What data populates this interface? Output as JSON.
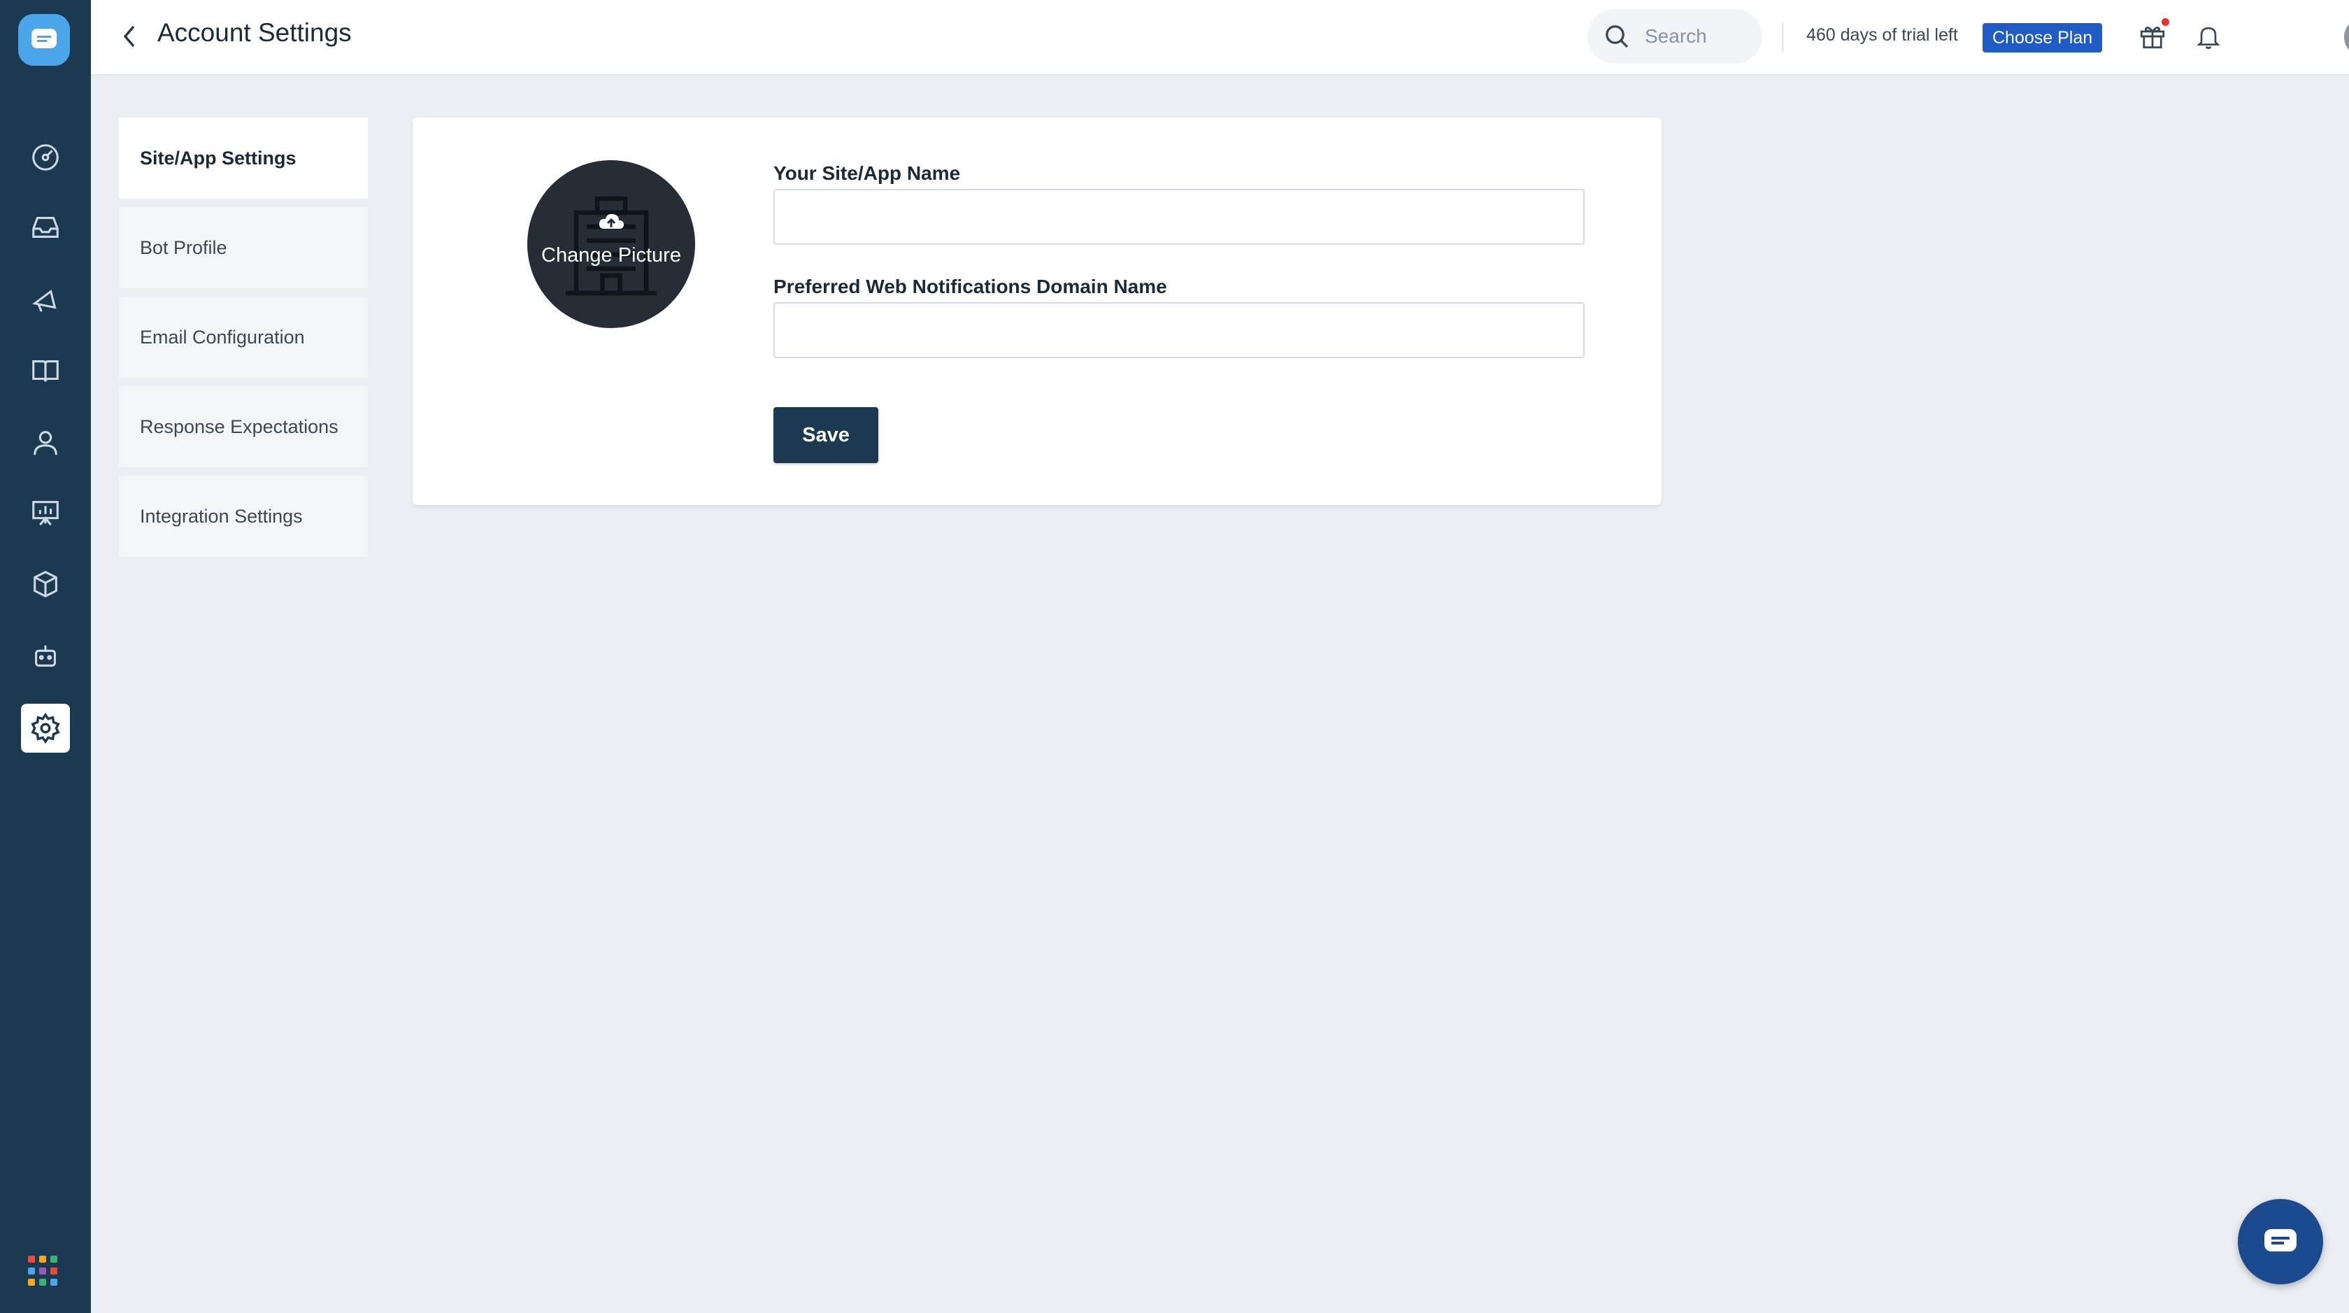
{
  "rail": {
    "items": [
      {
        "icon": "dashboard-icon"
      },
      {
        "icon": "inbox-icon"
      },
      {
        "icon": "campaigns-icon"
      },
      {
        "icon": "knowledge-base-icon"
      },
      {
        "icon": "contacts-icon"
      },
      {
        "icon": "reports-icon"
      },
      {
        "icon": "integrations-icon"
      },
      {
        "icon": "bot-icon"
      },
      {
        "icon": "settings-icon",
        "active": true
      }
    ],
    "apps_colors": [
      "#e94b3c",
      "#f5a623",
      "#3bb273",
      "#4aa6e8",
      "#9b59b6",
      "#e94b3c",
      "#f5a623",
      "#3bb273",
      "#4aa6e8"
    ]
  },
  "header": {
    "title": "Account Settings",
    "search_placeholder": "Search",
    "trial_text": "460 days of trial left",
    "choose_plan_label": "Choose Plan"
  },
  "settings_nav": {
    "items": [
      {
        "label": "Site/App Settings",
        "active": true
      },
      {
        "label": "Bot Profile"
      },
      {
        "label": "Email Configuration"
      },
      {
        "label": "Response Expectations"
      },
      {
        "label": "Integration Settings"
      }
    ]
  },
  "form": {
    "picture_label": "Change Picture",
    "site_name_label": "Your Site/App Name",
    "site_name_value": "",
    "domain_label": "Preferred Web Notifications Domain Name",
    "domain_value": "",
    "save_label": "Save"
  },
  "colors": {
    "rail_bg": "#1b3a52",
    "accent": "#1f5bc4",
    "save_bg": "#1b3a52"
  }
}
